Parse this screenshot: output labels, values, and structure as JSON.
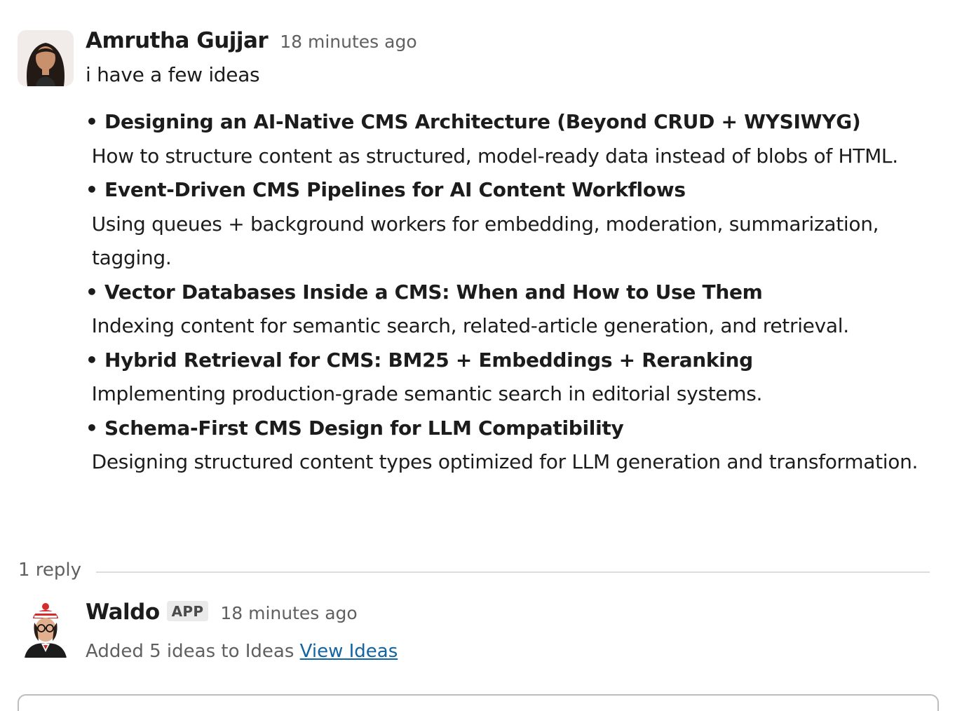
{
  "messages": [
    {
      "author": "Amrutha Gujjar",
      "timestamp": "18 minutes ago",
      "text": "i have a few ideas",
      "ideas": [
        {
          "title": "Designing an AI-Native CMS Architecture (Beyond CRUD + WYSIWYG)",
          "description": "How to structure content as structured, model-ready data instead of blobs of HTML."
        },
        {
          "title": "Event-Driven CMS Pipelines for AI Content Workflows",
          "description": "Using queues + background workers for embedding, moderation, summarization, tagging."
        },
        {
          "title": "Vector Databases Inside a CMS: When and How to Use Them",
          "description": "Indexing content for semantic search, related-article generation, and retrieval."
        },
        {
          "title": "Hybrid Retrieval for CMS: BM25 + Embeddings + Reranking",
          "description": "Implementing production-grade semantic search in editorial systems."
        },
        {
          "title": "Schema-First CMS Design for LLM Compatibility",
          "description": "Designing structured content types optimized for LLM generation and transformation."
        }
      ]
    }
  ],
  "thread": {
    "reply_count": "1 reply"
  },
  "reply": {
    "author": "Waldo",
    "badge": "APP",
    "timestamp": "18 minutes ago",
    "text": "Added 5 ideas to Ideas",
    "link_label": "View Ideas"
  },
  "colors": {
    "link": "#1264a3",
    "muted_text": "#616061",
    "primary_text": "#1d1c1d",
    "divider": "#dddddd"
  },
  "icons": {
    "amrutha_avatar": "user-avatar-photo",
    "waldo_avatar": "waldo-bot-avatar"
  }
}
